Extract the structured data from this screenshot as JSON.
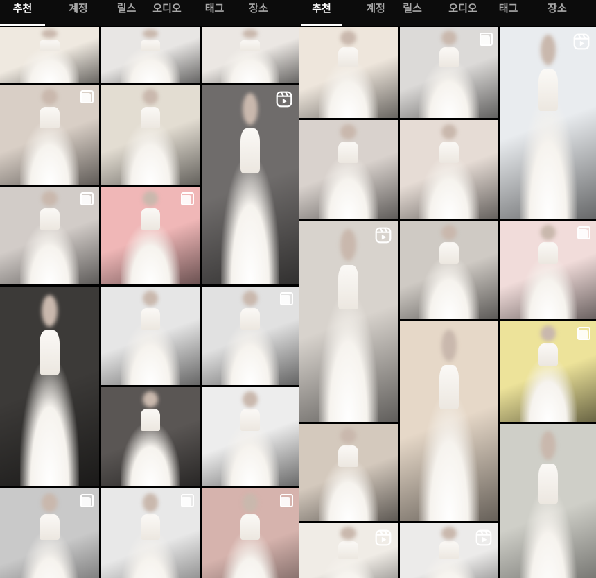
{
  "panels": [
    {
      "id": "left",
      "tabs": [
        {
          "label": "추천",
          "active": true
        },
        {
          "label": "계정",
          "active": false
        },
        {
          "label": "릴스",
          "active": false
        },
        {
          "label": "오디오",
          "active": false
        },
        {
          "label": "태그",
          "active": false
        },
        {
          "label": "장소",
          "active": false
        }
      ],
      "tiles": [
        {
          "name": "post-ivory-ballgown-skirt",
          "badge": "none",
          "tone": "#efe9e0"
        },
        {
          "name": "post-white-skirt-studio",
          "badge": "none",
          "tone": "#e8e6e4"
        },
        {
          "name": "post-bride-bouquet-skirt",
          "badge": "none",
          "tone": "#ebe7e3"
        },
        {
          "name": "post-strapless-bouquet",
          "badge": "multi",
          "tone": "#d9cfc6"
        },
        {
          "name": "post-lace-capsleeve-gown",
          "badge": "none",
          "tone": "#e3ddd2"
        },
        {
          "name": "post-sparkle-ballgown",
          "badge": "reels",
          "tone": "#6f6c6b"
        },
        {
          "name": "post-seated-tulle-bride",
          "badge": "multi",
          "tone": "#d2ccc8"
        },
        {
          "name": "post-pink-backdrop-gown",
          "badge": "multi",
          "tone": "#f0b7b7"
        },
        {
          "name": "post-dark-blurred-skirt",
          "badge": "none",
          "tone": "#3c3a38"
        },
        {
          "name": "post-aline-gown-grey",
          "badge": "none",
          "tone": "#e6e6e6"
        },
        {
          "name": "post-satin-aline-studio",
          "badge": "multi",
          "tone": "#e1e1e1"
        },
        {
          "name": "post-glitter-train",
          "badge": "none",
          "tone": "#5a5654"
        },
        {
          "name": "post-mermaid-satin-white",
          "badge": "none",
          "tone": "#ededed"
        },
        {
          "name": "post-bw-bride-holding-skirt",
          "badge": "multi",
          "tone": "#c9c9c9"
        },
        {
          "name": "post-offshoulder-bride",
          "badge": "multi",
          "tone": "#e8e8e8"
        },
        {
          "name": "post-pink-sofa-gown",
          "badge": "multi",
          "tone": "#d6b3ad"
        },
        {
          "name": "post-fitting-room-reels",
          "badge": "reels",
          "tone": "#9c9592"
        }
      ]
    },
    {
      "id": "right",
      "tabs": [
        {
          "label": "추천",
          "active": true
        },
        {
          "label": "계정",
          "active": false
        },
        {
          "label": "릴스",
          "active": false
        },
        {
          "label": "오디오",
          "active": false
        },
        {
          "label": "태그",
          "active": false
        },
        {
          "label": "장소",
          "active": false
        }
      ],
      "tiles": [
        {
          "name": "post-offshoulder-ivory",
          "badge": "none",
          "tone": "#eee6dc"
        },
        {
          "name": "post-dress-rack-mannequins",
          "badge": "multi",
          "tone": "#dcdad8"
        },
        {
          "name": "post-asymmetric-mannequin-window",
          "badge": "reels",
          "tone": "#e9ecef"
        },
        {
          "name": "post-sweetheart-bride",
          "badge": "none",
          "tone": "#d9d2cd"
        },
        {
          "name": "post-lace-closeup",
          "badge": "none",
          "tone": "#e6dcd5"
        },
        {
          "name": "post-lace-gowns-hangers",
          "badge": "reels",
          "tone": "#d8d3cd"
        },
        {
          "name": "post-polka-dot-gown",
          "badge": "none",
          "tone": "#cfcac4"
        },
        {
          "name": "post-pink-short-dress",
          "badge": "multi",
          "tone": "#f1dcda"
        },
        {
          "name": "post-satin-cap-sleeve",
          "badge": "none",
          "tone": "#e6d8c8"
        },
        {
          "name": "post-yellow-vneck-dress",
          "badge": "multi",
          "tone": "#ede39a"
        },
        {
          "name": "post-mirror-bride-curtains",
          "badge": "none",
          "tone": "#d4c9bd"
        },
        {
          "name": "post-blurred-garden-bride",
          "badge": "none",
          "tone": "#cfcfc8"
        },
        {
          "name": "post-puff-sleeve-window",
          "badge": "reels",
          "tone": "#f0ece6"
        },
        {
          "name": "post-bride-bouquet-tall",
          "badge": "reels",
          "tone": "#ecebea"
        },
        {
          "name": "post-blurred-bride-closeup",
          "badge": "none",
          "tone": "#d9cfc8"
        }
      ]
    }
  ],
  "colors": {
    "background": "#000000",
    "tab_bar": "#0c0c0c",
    "tab_active": "#ffffff",
    "tab_inactive": "#a8a8a8"
  }
}
